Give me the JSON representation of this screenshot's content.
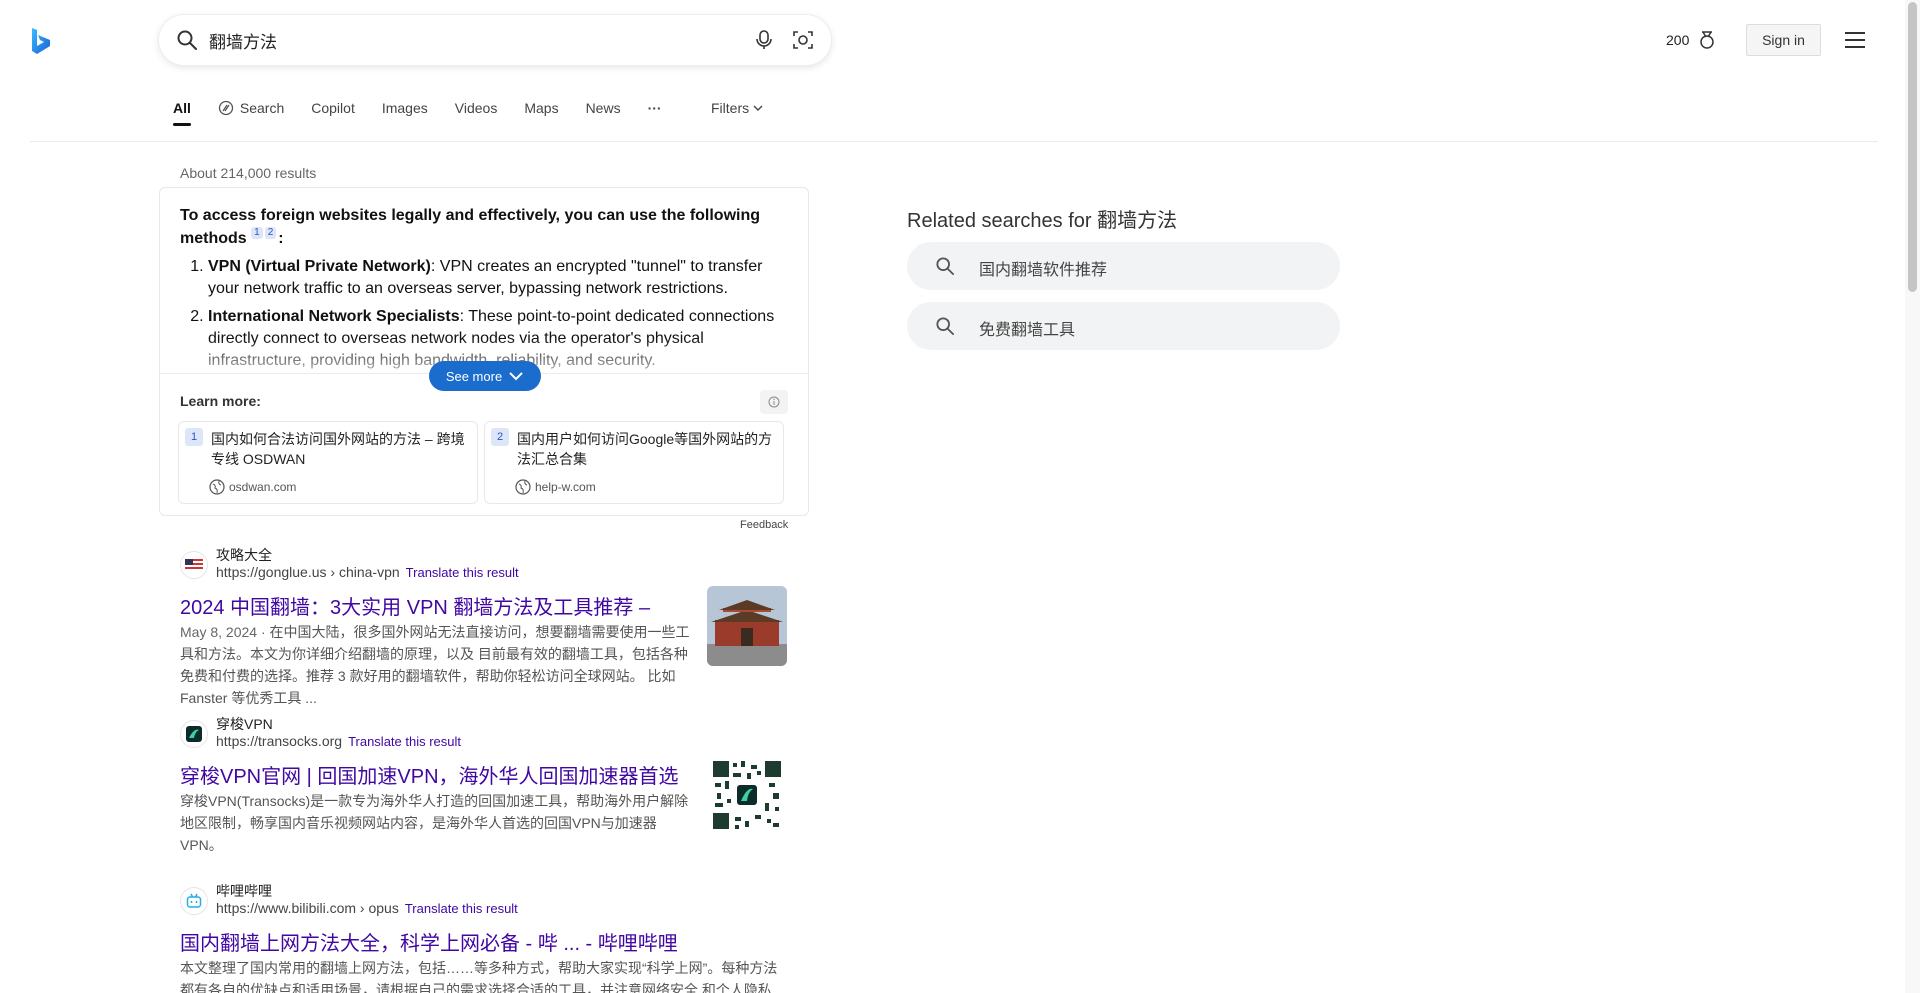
{
  "search": {
    "query": "翻墙方法",
    "placeholder": ""
  },
  "header": {
    "rewards_points": "200",
    "signin_label": "Sign in"
  },
  "tabs": [
    {
      "label": "All",
      "active": true
    },
    {
      "label": "Search"
    },
    {
      "label": "Copilot"
    },
    {
      "label": "Images"
    },
    {
      "label": "Videos"
    },
    {
      "label": "Maps"
    },
    {
      "label": "News"
    },
    {
      "label": "···"
    }
  ],
  "filters_label": "Filters",
  "results_count": "About 214,000 results",
  "answer": {
    "intro": "To access foreign websites legally and effectively, you can use the following methods",
    "refs": [
      "1",
      "2"
    ],
    "items": [
      {
        "term": "VPN (Virtual Private Network)",
        "text": ": VPN creates an encrypted \"tunnel\" to transfer your network traffic to an overseas server, bypassing network restrictions."
      },
      {
        "term": "International Network Specialists",
        "text": ": These point-to-point dedicated connections directly connect to overseas network nodes via the operator's physical infrastructure, providing high bandwidth, reliability, and security."
      }
    ],
    "see_more": "See more",
    "learn_more": "Learn more:",
    "sources": [
      {
        "num": "1",
        "title": "国内如何合法访问国外网站的方法 – 跨境专线 OSDWAN",
        "site": "osdwan.com"
      },
      {
        "num": "2",
        "title": "国内用户如何访问Google等国外网站的方法汇总合集",
        "site": "help-w.com"
      }
    ],
    "feedback": "Feedback"
  },
  "results": [
    {
      "site": "攻略大全",
      "url": "https://gonglue.us › china-vpn",
      "translate": "Translate this result",
      "title": "2024 中国翻墙：3大实用 VPN 翻墙方法及工具推荐 –",
      "date": "May 8, 2024 · ",
      "snippet": "在中国大陆，很多国外网站无法直接访问，想要翻墙需要使用一些工具和方法。本文为你详细介绍翻墙的原理，以及 目前最有效的翻墙工具，包括各种免费和付费的选择。推荐 3 款好用的翻墙软件，帮助你轻松访问全球网站。 比如 Fanster 等优秀工具 ..."
    },
    {
      "site": "穿梭VPN",
      "url": "https://transocks.org",
      "translate": "Translate this result",
      "title": "穿梭VPN官网 | 回国加速VPN，海外华人回国加速器首选",
      "date": "",
      "snippet": "穿梭VPN(Transocks)是一款专为海外华人打造的回国加速工具，帮助海外用户解除地区限制，畅享国内音乐视频网站内容，是海外华人首选的回国VPN与加速器VPN。"
    },
    {
      "site": "哔哩哔哩",
      "url": "https://www.bilibili.com › opus",
      "translate": "Translate this result",
      "title": "国内翻墙上网方法大全，科学上网必备 - 哔 ... - 哔哩哔哩",
      "date": "",
      "snippet": "本文整理了国内常用的翻墙上网方法，包括……等多种方式，帮助大家实现“科学上网”。每种方法都有各自的优缺点和适用场景，请根据自己的需求选择合适的工具，并注意网络安全 和个人隐私保护，合理合法地使用网络资源 ..."
    }
  ],
  "related": {
    "title": "Related searches for 翻墙方法",
    "items": [
      "国内翻墙软件推荐",
      "免费翻墙工具"
    ]
  },
  "colors": {
    "link": "#4007a2",
    "accent": "#1a6dcd",
    "brand": "#1a6dcd"
  }
}
